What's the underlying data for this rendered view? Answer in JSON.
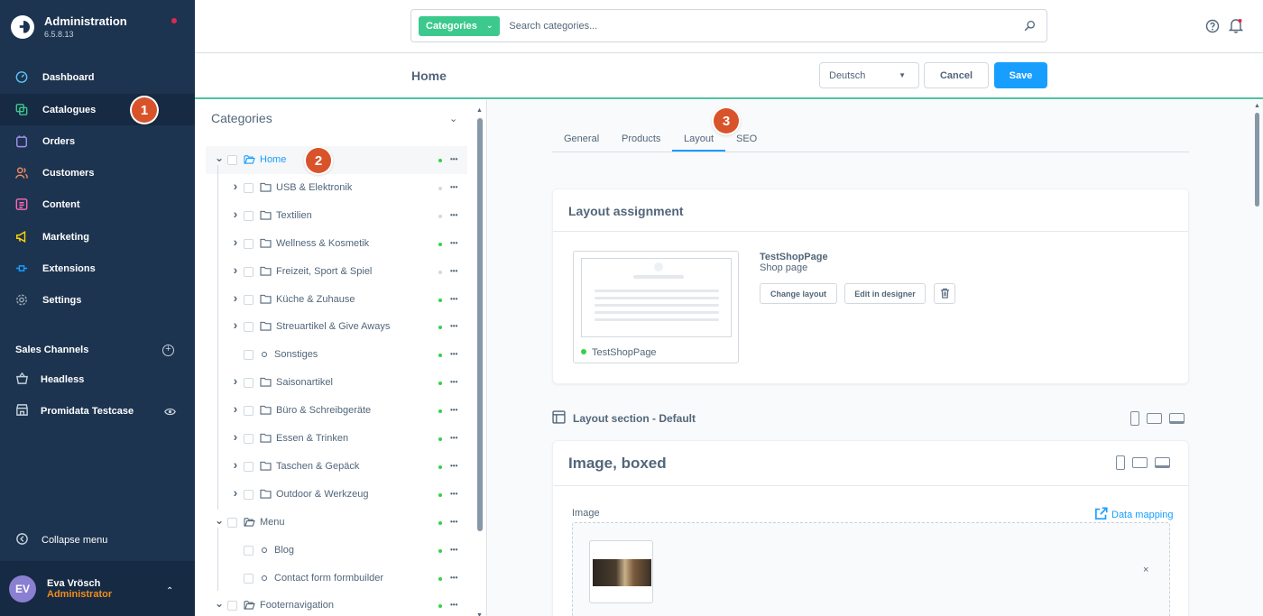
{
  "app": {
    "title": "Administration",
    "version": "6.5.8.13"
  },
  "nav": [
    {
      "label": "Dashboard",
      "icon": "dashboard-icon"
    },
    {
      "label": "Catalogues",
      "icon": "catalogue-icon",
      "active": true
    },
    {
      "label": "Orders",
      "icon": "orders-icon"
    },
    {
      "label": "Customers",
      "icon": "customers-icon"
    },
    {
      "label": "Content",
      "icon": "content-icon"
    },
    {
      "label": "Marketing",
      "icon": "marketing-icon"
    },
    {
      "label": "Extensions",
      "icon": "extensions-icon"
    },
    {
      "label": "Settings",
      "icon": "settings-icon"
    }
  ],
  "sales_channels": {
    "title": "Sales Channels",
    "items": [
      {
        "label": "Headless",
        "icon": "basket-icon"
      },
      {
        "label": "Promidata Testcase",
        "icon": "storefront-icon"
      }
    ]
  },
  "collapse_label": "Collapse menu",
  "user": {
    "initials": "EV",
    "name": "Eva Vrösch",
    "role": "Administrator"
  },
  "annotations": [
    "1",
    "2",
    "3"
  ],
  "search": {
    "type": "Categories",
    "placeholder": "Search categories..."
  },
  "smartbar": {
    "title": "Home",
    "language": "Deutsch",
    "cancel": "Cancel",
    "save": "Save"
  },
  "tree": {
    "title": "Categories",
    "rows": [
      {
        "label": "Home",
        "type": "folder-open",
        "expand": "open",
        "depth": 0,
        "status": "green",
        "selected": true
      },
      {
        "label": "USB & Elektronik",
        "type": "folder",
        "expand": "closed",
        "depth": 1,
        "status": "grey"
      },
      {
        "label": "Textilien",
        "type": "folder",
        "expand": "closed",
        "depth": 1,
        "status": "grey"
      },
      {
        "label": "Wellness & Kosmetik",
        "type": "folder",
        "expand": "closed",
        "depth": 1,
        "status": "green"
      },
      {
        "label": "Freizeit, Sport & Spiel",
        "type": "folder",
        "expand": "closed",
        "depth": 1,
        "status": "grey"
      },
      {
        "label": "Küche & Zuhause",
        "type": "folder",
        "expand": "closed",
        "depth": 1,
        "status": "green"
      },
      {
        "label": "Streuartikel & Give Aways",
        "type": "folder",
        "expand": "closed",
        "depth": 1,
        "status": "green"
      },
      {
        "label": "Sonstiges",
        "type": "leaf",
        "expand": "none",
        "depth": 1,
        "status": "green"
      },
      {
        "label": "Saisonartikel",
        "type": "folder",
        "expand": "closed",
        "depth": 1,
        "status": "green"
      },
      {
        "label": "Büro & Schreibgeräte",
        "type": "folder",
        "expand": "closed",
        "depth": 1,
        "status": "green"
      },
      {
        "label": "Essen & Trinken",
        "type": "folder",
        "expand": "closed",
        "depth": 1,
        "status": "green"
      },
      {
        "label": "Taschen & Gepäck",
        "type": "folder",
        "expand": "closed",
        "depth": 1,
        "status": "green"
      },
      {
        "label": "Outdoor & Werkzeug",
        "type": "folder",
        "expand": "closed",
        "depth": 1,
        "status": "green"
      },
      {
        "label": "Menu",
        "type": "folder-open",
        "expand": "open",
        "depth": 0,
        "status": "green"
      },
      {
        "label": "Blog",
        "type": "leaf",
        "expand": "none",
        "depth": 1,
        "status": "green"
      },
      {
        "label": "Contact form formbuilder",
        "type": "leaf",
        "expand": "none",
        "depth": 1,
        "status": "green"
      },
      {
        "label": "Footernavigation",
        "type": "folder-open",
        "expand": "open",
        "depth": 0,
        "status": "green"
      }
    ]
  },
  "tabs": [
    "General",
    "Products",
    "Layout",
    "SEO"
  ],
  "active_tab": "Layout",
  "layout_assignment": {
    "title": "Layout assignment",
    "preview_name": "TestShopPage",
    "layout_name": "TestShopPage",
    "layout_type": "Shop page",
    "change": "Change layout",
    "edit": "Edit in designer"
  },
  "section": {
    "title": "Layout section - Default"
  },
  "element": {
    "title": "Image, boxed",
    "image_label": "Image",
    "data_mapping": "Data mapping",
    "close": "×"
  },
  "colors": {
    "sidebar": "#1d3450",
    "accent": "#189eff",
    "search_type": "#3cc98d",
    "status_green": "#37d046",
    "annotation": "#d9532a"
  }
}
